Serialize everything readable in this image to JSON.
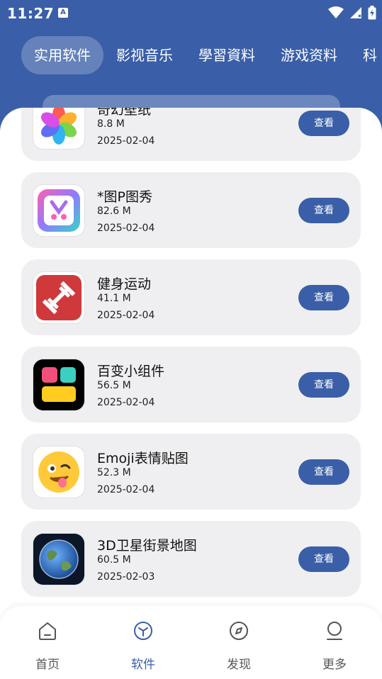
{
  "status_bar": {
    "time": "11:27",
    "notification_icon": "A"
  },
  "tabs": [
    {
      "label": "实用软件",
      "active": true
    },
    {
      "label": "影视音乐",
      "active": false
    },
    {
      "label": "學習資料",
      "active": false
    },
    {
      "label": "游戏资料",
      "active": false
    },
    {
      "label": "科",
      "active": false
    }
  ],
  "apps": [
    {
      "name": "奇幻壁纸",
      "size": "8.8 M",
      "date": "2025-02-04",
      "button": "查看",
      "icon": "flower-icon"
    },
    {
      "name": "*图P图秀",
      "size": "82.6 M",
      "date": "2025-02-04",
      "button": "查看",
      "icon": "scissors-app-icon"
    },
    {
      "name": "健身运动",
      "size": "41.1 M",
      "date": "2025-02-04",
      "button": "查看",
      "icon": "dumbbell-icon"
    },
    {
      "name": "百变小组件",
      "size": "56.5 M",
      "date": "2025-02-04",
      "button": "查看",
      "icon": "widgets-icon"
    },
    {
      "name": "Emoji表情贴图",
      "size": "52.3 M",
      "date": "2025-02-04",
      "button": "查看",
      "icon": "emoji-icon"
    },
    {
      "name": "3D卫星街景地图",
      "size": "60.5 M",
      "date": "2025-02-03",
      "button": "查看",
      "icon": "earth-icon"
    }
  ],
  "bottom_nav": [
    {
      "label": "首页",
      "icon": "home-icon",
      "active": false
    },
    {
      "label": "软件",
      "icon": "cube-icon",
      "active": true
    },
    {
      "label": "发现",
      "icon": "compass-icon",
      "active": false
    },
    {
      "label": "更多",
      "icon": "user-icon",
      "active": false
    }
  ],
  "colors": {
    "primary": "#3a5fa8",
    "card_bg": "#efeff1"
  }
}
